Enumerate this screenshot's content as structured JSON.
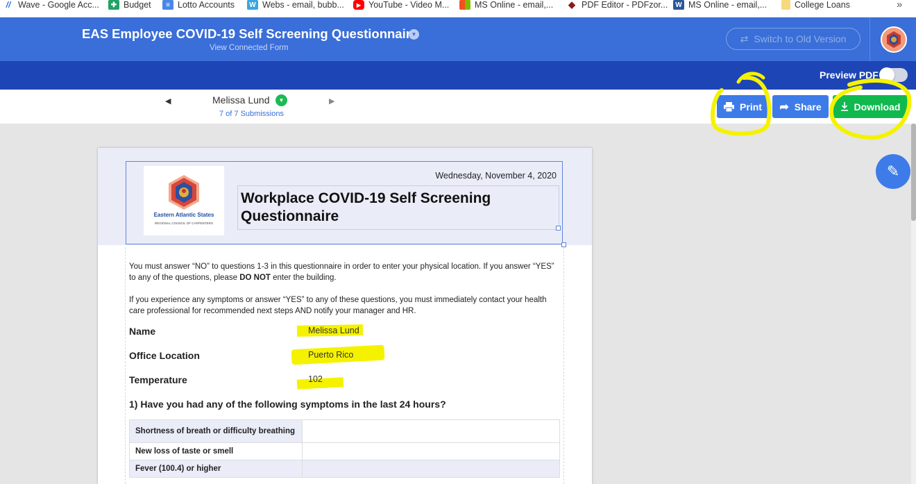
{
  "bookmarks": [
    {
      "label": "Wave - Google Acc...",
      "icon": "wave-icon"
    },
    {
      "label": "Budget",
      "icon": "sheets-icon"
    },
    {
      "label": "Lotto Accounts",
      "icon": "docs-icon"
    },
    {
      "label": "Webs - email, bubb...",
      "icon": "webs-icon"
    },
    {
      "label": "YouTube - Video M...",
      "icon": "youtube-icon"
    },
    {
      "label": "MS Online - email,...",
      "icon": "microsoft-icon"
    },
    {
      "label": "PDF Editor - PDFzor...",
      "icon": "pdf-icon"
    },
    {
      "label": "MS Online - email,...",
      "icon": "word-icon"
    },
    {
      "label": "College Loans",
      "icon": "folder-icon"
    }
  ],
  "header": {
    "title": "EAS Employee COVID-19 Self Screening Questionnaire",
    "subtitle": "View Connected Form",
    "switch_label": "Switch to Old Version"
  },
  "subbar": {
    "preview_label": "Preview PDF",
    "preview_on": false
  },
  "toolbar": {
    "submitter": "Melissa Lund",
    "submission_count": "7 of 7 Submissions",
    "print_label": "Print",
    "share_label": "Share",
    "download_label": "Download"
  },
  "document": {
    "date": "Wednesday, November 4, 2020",
    "title": "Workplace COVID-19 Self Screening Questionnaire",
    "logo": {
      "name": "Eastern Atlantic States",
      "subname": "REGIONAL COUNCIL OF CARPENTERS"
    },
    "intro1_a": "You must answer “NO” to questions 1-3 in this questionnaire in order to enter your physical location. If you answer “YES” to any of the questions, please ",
    "intro1_bold": "DO NOT",
    "intro1_b": " enter the building.",
    "intro2": "If you experience any symptoms or answer “YES” to any of these questions, you must immediately  contact your health care professional for recommended next steps AND notify your manager and HR.",
    "fields": [
      {
        "label": "Name",
        "value": "Melissa Lund"
      },
      {
        "label": "Office Location",
        "value": "Puerto Rico"
      },
      {
        "label": "Temperature",
        "value": "102"
      }
    ],
    "question1": "1) Have you had any of the following symptoms in the last 24 hours?",
    "symptoms": [
      {
        "label": "Shortness of breath or difficulty breathing",
        "answer": ""
      },
      {
        "label": "New loss of taste or smell",
        "answer": ""
      },
      {
        "label": "Fever (100.4) or higher",
        "answer": ""
      }
    ]
  },
  "colors": {
    "header_blue": "#3a6ed8",
    "subbar_blue": "#1e45b5",
    "print_blue": "#3d7be8",
    "download_green": "#10b94e",
    "highlighter_yellow": "#f5f200"
  }
}
